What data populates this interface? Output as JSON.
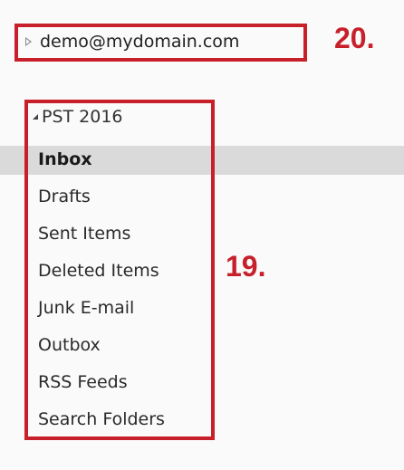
{
  "account": {
    "email": "demo@mydomain.com",
    "expander_icon": "collapsed-triangle-icon"
  },
  "pst": {
    "label": "PST 2016",
    "expander_icon": "expanded-triangle-icon"
  },
  "folders": [
    {
      "label": "Inbox",
      "selected": true
    },
    {
      "label": "Drafts",
      "selected": false
    },
    {
      "label": "Sent Items",
      "selected": false
    },
    {
      "label": "Deleted Items",
      "selected": false
    },
    {
      "label": "Junk E-mail",
      "selected": false
    },
    {
      "label": "Outbox",
      "selected": false
    },
    {
      "label": "RSS Feeds",
      "selected": false
    },
    {
      "label": "Search Folders",
      "selected": false
    }
  ],
  "annotations": {
    "account_marker": "20.",
    "folders_marker": "19.",
    "color": "#c8202a"
  }
}
